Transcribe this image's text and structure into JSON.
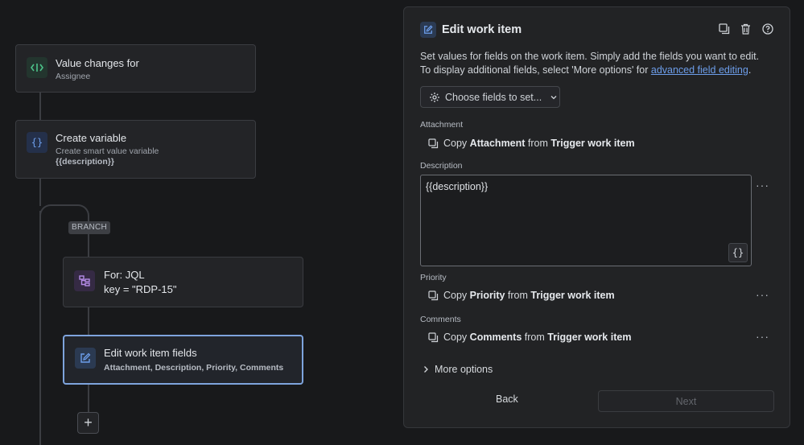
{
  "canvas": {
    "trigger": {
      "title": "Value changes for",
      "subtitle": "Assignee"
    },
    "create_variable": {
      "title": "Create variable",
      "subtitle": "Create smart value variable",
      "value": "{{description}}"
    },
    "branch_tag": "BRANCH",
    "for_jql": {
      "title": "For: JQL",
      "subtitle": "key = \"RDP-15\""
    },
    "edit_fields": {
      "title": "Edit work item fields",
      "subtitle": "Attachment, Description, Priority, Comments"
    },
    "add_icon": "plus-icon"
  },
  "panel": {
    "title": "Edit work item",
    "description_line1": "Set values for fields on the work item. Simply add the fields you want to edit.",
    "description_line2_prefix": "To display additional fields, select 'More options' for ",
    "description_link": "advanced field editing",
    "description_line2_suffix": ".",
    "choose_fields_label": "Choose fields to set...",
    "fields": {
      "attachment": {
        "label": "Attachment",
        "copy": "Copy",
        "field": "Attachment",
        "from": "from",
        "source": "Trigger work item"
      },
      "description": {
        "label": "Description",
        "value": "{{description}}",
        "braces": "{}"
      },
      "priority": {
        "label": "Priority",
        "copy": "Copy",
        "field": "Priority",
        "from": "from",
        "source": "Trigger work item"
      },
      "comments": {
        "label": "Comments",
        "copy": "Copy",
        "field": "Comments",
        "from": "from",
        "source": "Trigger work item"
      }
    },
    "more_options": "More options",
    "back_label": "Back",
    "next_label": "Next",
    "more_actions": "···"
  },
  "colors": {
    "accent": "#6d9eeb",
    "selected_border": "#7ea4dd",
    "background": "#18191b",
    "panel": "#222325"
  }
}
